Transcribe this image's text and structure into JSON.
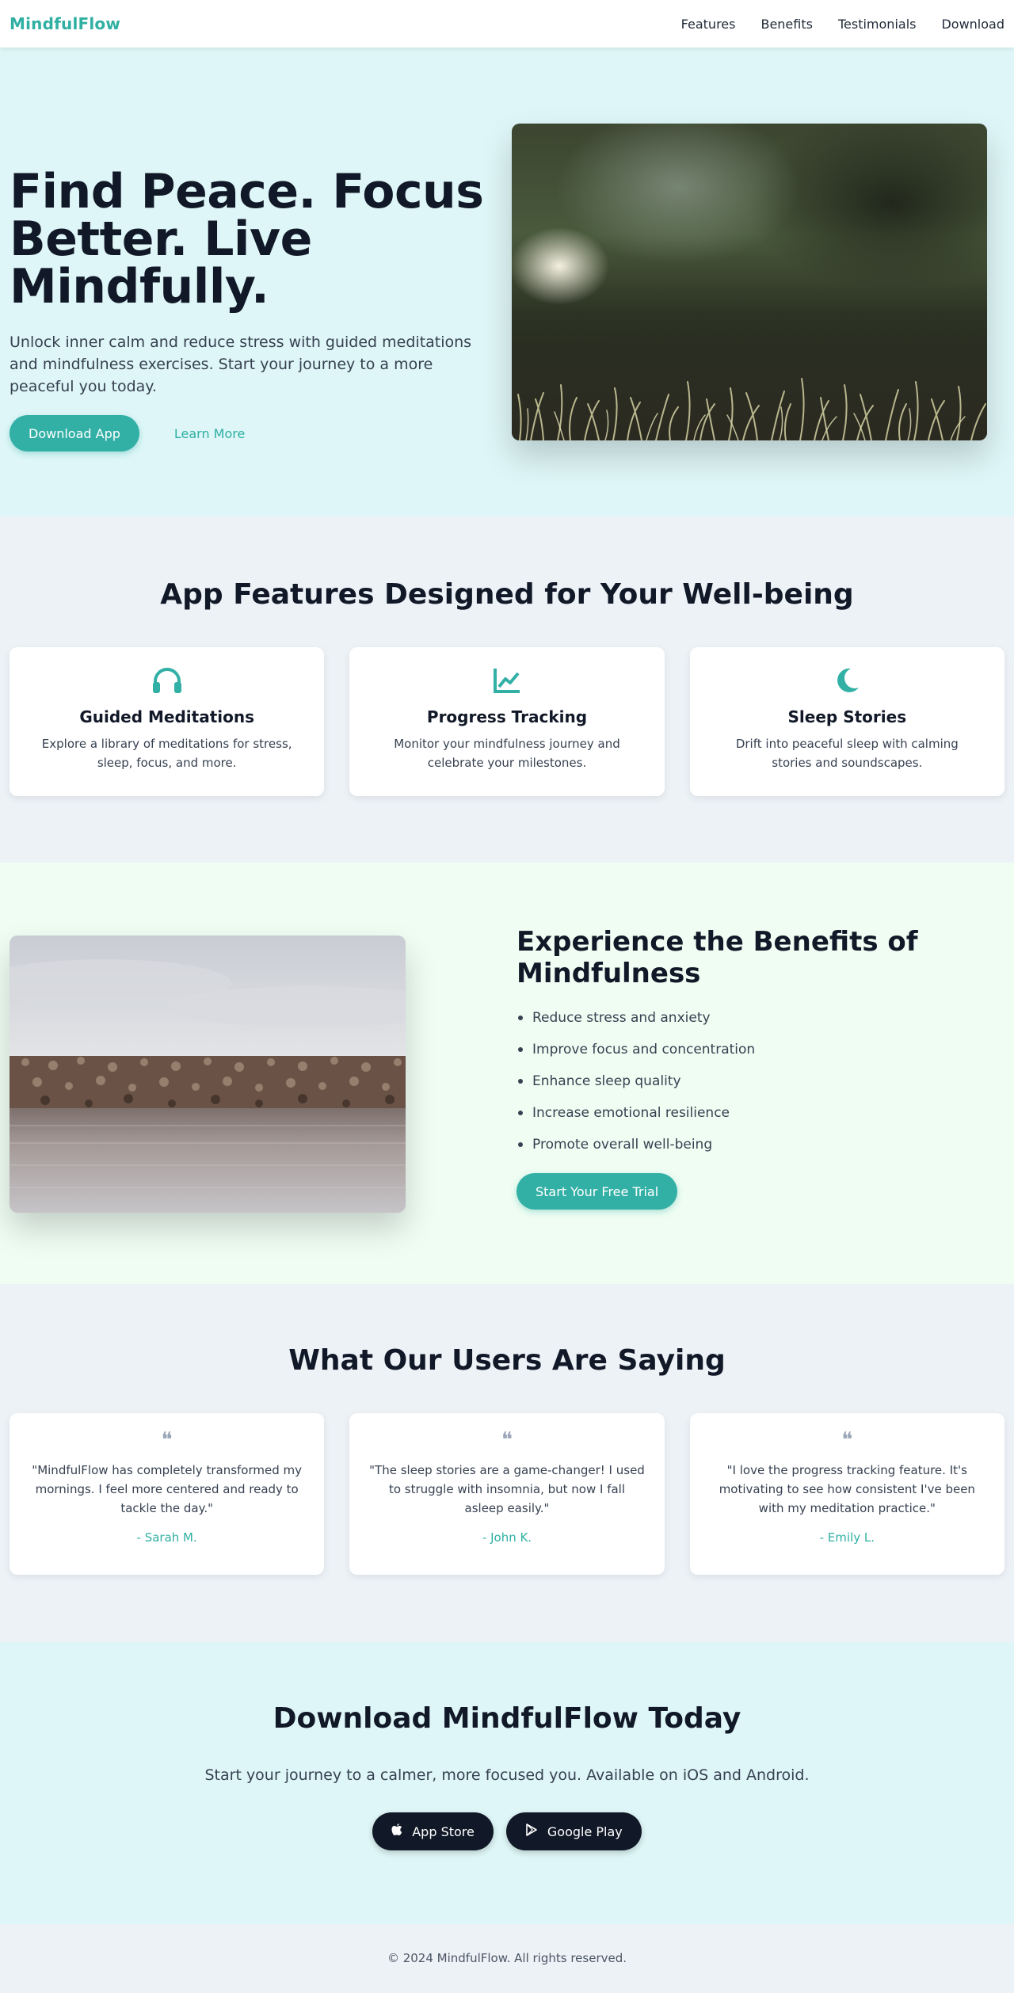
{
  "nav": {
    "brand": "MindfulFlow",
    "links": [
      "Features",
      "Benefits",
      "Testimonials",
      "Download"
    ]
  },
  "hero": {
    "title": "Find Peace. Focus Better. Live Mindfully.",
    "subtitle": "Unlock inner calm and reduce stress with guided meditations and mindfulness exercises. Start your journey to a more peaceful you today.",
    "primary_cta": "Download App",
    "secondary_cta": "Learn More"
  },
  "features": {
    "title": "App Features Designed for Your Well-being",
    "items": [
      {
        "icon": "headphones-icon",
        "title": "Guided Meditations",
        "desc": "Explore a library of meditations for stress, sleep, focus, and more."
      },
      {
        "icon": "chart-line-icon",
        "title": "Progress Tracking",
        "desc": "Monitor your mindfulness journey and celebrate your milestones."
      },
      {
        "icon": "moon-icon",
        "title": "Sleep Stories",
        "desc": "Drift into peaceful sleep with calming stories and soundscapes."
      }
    ]
  },
  "benefits": {
    "title": "Experience the Benefits of Mindfulness",
    "items": [
      "Reduce stress and anxiety",
      "Improve focus and concentration",
      "Enhance sleep quality",
      "Increase emotional resilience",
      "Promote overall well-being"
    ],
    "cta": "Start Your Free Trial"
  },
  "testimonials": {
    "title": "What Our Users Are Saying",
    "items": [
      {
        "quote": "\"MindfulFlow has completely transformed my mornings. I feel more centered and ready to tackle the day.\"",
        "author": "- Sarah M."
      },
      {
        "quote": "\"The sleep stories are a game-changer! I used to struggle with insomnia, but now I fall asleep easily.\"",
        "author": "- John K."
      },
      {
        "quote": "\"I love the progress tracking feature. It's motivating to see how consistent I've been with my meditation practice.\"",
        "author": "- Emily L."
      }
    ]
  },
  "download": {
    "title": "Download MindfulFlow Today",
    "subtitle": "Start your journey to a calmer, more focused you. Available on iOS and Android.",
    "app_store": "App Store",
    "google_play": "Google Play"
  },
  "footer": {
    "text": "© 2024 MindfulFlow. All rights reserved."
  },
  "colors": {
    "accent": "#33b0a6",
    "hero_bg": "#def6f7",
    "benefits_bg": "#effdf3",
    "section_bg": "#edf2f7",
    "dark": "#111827"
  }
}
